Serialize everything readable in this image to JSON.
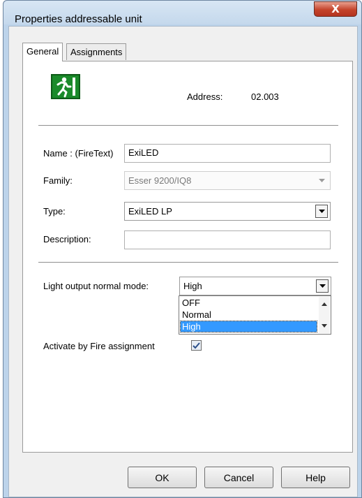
{
  "window": {
    "title": "Properties addressable unit",
    "close_label": "X"
  },
  "tabs": [
    {
      "label": "General"
    },
    {
      "label": "Assignments"
    }
  ],
  "general": {
    "logo_icon": "emergency-exit-running-man-icon",
    "address_label": "Address:",
    "address_value": "02.003",
    "name_label": "Name : (FireText)",
    "name_value": "ExiLED",
    "family_label": "Family:",
    "family_value": "Esser 9200/IQ8",
    "type_label": "Type:",
    "type_value": "ExiLED LP",
    "description_label": "Description:",
    "description_value": "",
    "light_output_label": "Light output normal mode:",
    "light_output_value": "High",
    "light_output_options": [
      "OFF",
      "Normal",
      "High"
    ],
    "light_output_selected_index": 2,
    "activate_label": "Activate by Fire assignment",
    "activate_checked": true
  },
  "buttons": {
    "ok": "OK",
    "cancel": "Cancel",
    "help": "Help"
  },
  "colors": {
    "selection": "#3399ff",
    "logo_green": "#1a8a2a",
    "close_red": "#c4432b"
  }
}
